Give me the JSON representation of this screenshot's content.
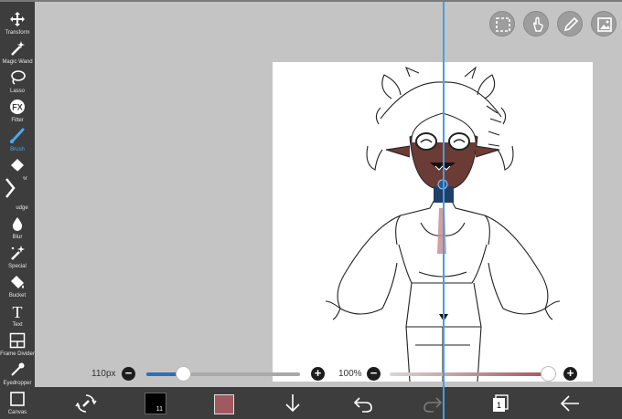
{
  "tools": [
    {
      "label": "Transform",
      "icon": "transform-icon"
    },
    {
      "label": "Magic Wand",
      "icon": "magic-wand-icon"
    },
    {
      "label": "Lasso",
      "icon": "lasso-icon"
    },
    {
      "label": "Filter",
      "icon": "filter-fx-icon"
    },
    {
      "label": "Brush",
      "icon": "brush-icon",
      "active": true
    },
    {
      "label": "Eraser",
      "icon": "eraser-icon"
    },
    {
      "label": "Smudge",
      "icon": "smudge-icon"
    },
    {
      "label": "Blur",
      "icon": "blur-icon"
    },
    {
      "label": "Special",
      "icon": "special-icon"
    },
    {
      "label": "Bucket",
      "icon": "bucket-icon"
    },
    {
      "label": "Text",
      "icon": "text-icon"
    },
    {
      "label": "Frame Divider",
      "icon": "frame-divider-icon"
    },
    {
      "label": "Eyedropper",
      "icon": "eyedropper-icon"
    },
    {
      "label": "Canvas",
      "icon": "canvas-icon"
    }
  ],
  "visible_labels": {
    "eraser_partial": "aser",
    "smudge_partial": "udge"
  },
  "top_buttons": [
    "selection-icon",
    "touch-icon",
    "pen-icon",
    "gallery-icon"
  ],
  "size_slider": {
    "label": "110px",
    "value_fraction": 0.24,
    "fill_color": "#2e6fb6"
  },
  "opacity_slider": {
    "label": "100%",
    "value_fraction": 1.0
  },
  "bottom_bar": {
    "primary_color": "#000000",
    "primary_color_badge": "11",
    "secondary_color": "#a0595e",
    "icons": [
      "brush-settings-icon",
      "import-down-icon",
      "undo-icon",
      "redo-icon",
      "layers-icon",
      "back-arrow-icon"
    ],
    "layer_count": "1"
  },
  "colors": {
    "toolbar_bg": "#3d3d3d",
    "workspace_bg": "#c4c4c4",
    "accent": "#4aa8ea",
    "guide": "#4a9ee0"
  }
}
